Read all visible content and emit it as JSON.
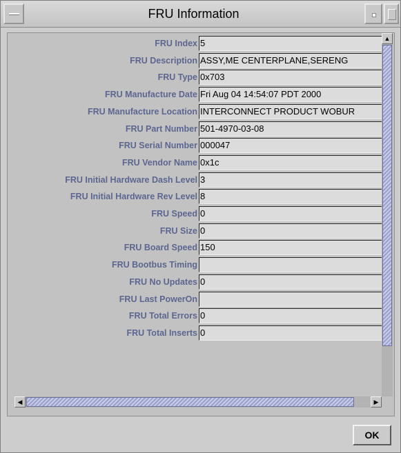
{
  "window": {
    "title": "FRU Information"
  },
  "fields": [
    {
      "label": "FRU Index",
      "value": "5"
    },
    {
      "label": "FRU Description",
      "value": "ASSY,ME CENTERPLANE,SERENG"
    },
    {
      "label": "FRU Type",
      "value": "0x703"
    },
    {
      "label": "FRU Manufacture Date",
      "value": "Fri Aug 04 14:54:07 PDT 2000"
    },
    {
      "label": "FRU Manufacture Location",
      "value": "INTERCONNECT PRODUCT WOBUR"
    },
    {
      "label": "FRU Part Number",
      "value": "501-4970-03-08"
    },
    {
      "label": "FRU Serial Number",
      "value": "000047"
    },
    {
      "label": "FRU Vendor Name",
      "value": "0x1c"
    },
    {
      "label": "FRU Initial Hardware Dash Level",
      "value": "3"
    },
    {
      "label": "FRU Initial Hardware Rev Level",
      "value": "8"
    },
    {
      "label": "FRU Speed",
      "value": "0"
    },
    {
      "label": "FRU Size",
      "value": "0"
    },
    {
      "label": "FRU Board Speed",
      "value": "150"
    },
    {
      "label": "FRU Bootbus Timing",
      "value": ""
    },
    {
      "label": "FRU No Updates",
      "value": "0"
    },
    {
      "label": "FRU Last PowerOn",
      "value": ""
    },
    {
      "label": "FRU Total Errors",
      "value": "0"
    },
    {
      "label": "FRU Total Inserts",
      "value": "0"
    }
  ],
  "icons": {
    "window_menu": "window-menu-icon",
    "minimize": "minimize-icon",
    "maximize": "maximize-icon",
    "scroll_up": "arrow-up-icon",
    "scroll_down": "arrow-down-icon",
    "scroll_left": "arrow-left-icon",
    "scroll_right": "arrow-right-icon"
  },
  "colors": {
    "label_text": "#5c6690",
    "scroll_thumb": "#9aa0c8"
  },
  "buttons": {
    "ok_label": "OK"
  }
}
